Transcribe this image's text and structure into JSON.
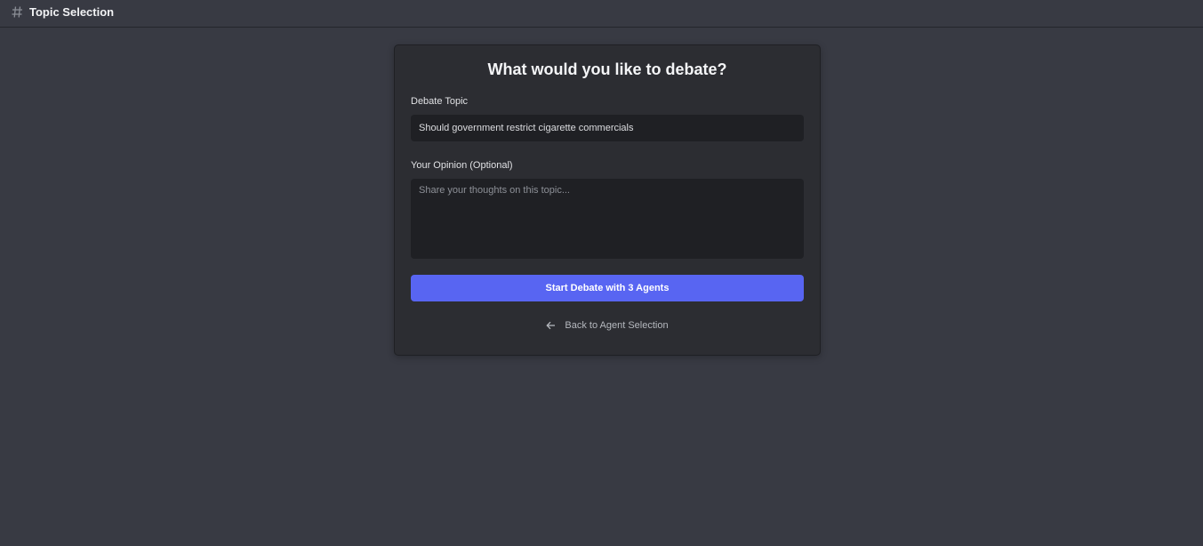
{
  "header": {
    "icon": "hash-icon",
    "title": "Topic Selection"
  },
  "card": {
    "title": "What would you like to debate?",
    "topic_field": {
      "label": "Debate Topic",
      "value": "Should government restrict cigarette commercials"
    },
    "opinion_field": {
      "label": "Your Opinion (Optional)",
      "placeholder": "Share your thoughts on this topic...",
      "value": ""
    },
    "start_button_label": "Start Debate with 3 Agents",
    "back_link": {
      "icon": "arrow-left-icon",
      "label": "Back to Agent Selection"
    }
  },
  "colors": {
    "background": "#383a43",
    "card": "#2c2d32",
    "input": "#1f2024",
    "accent": "#5865f2"
  }
}
